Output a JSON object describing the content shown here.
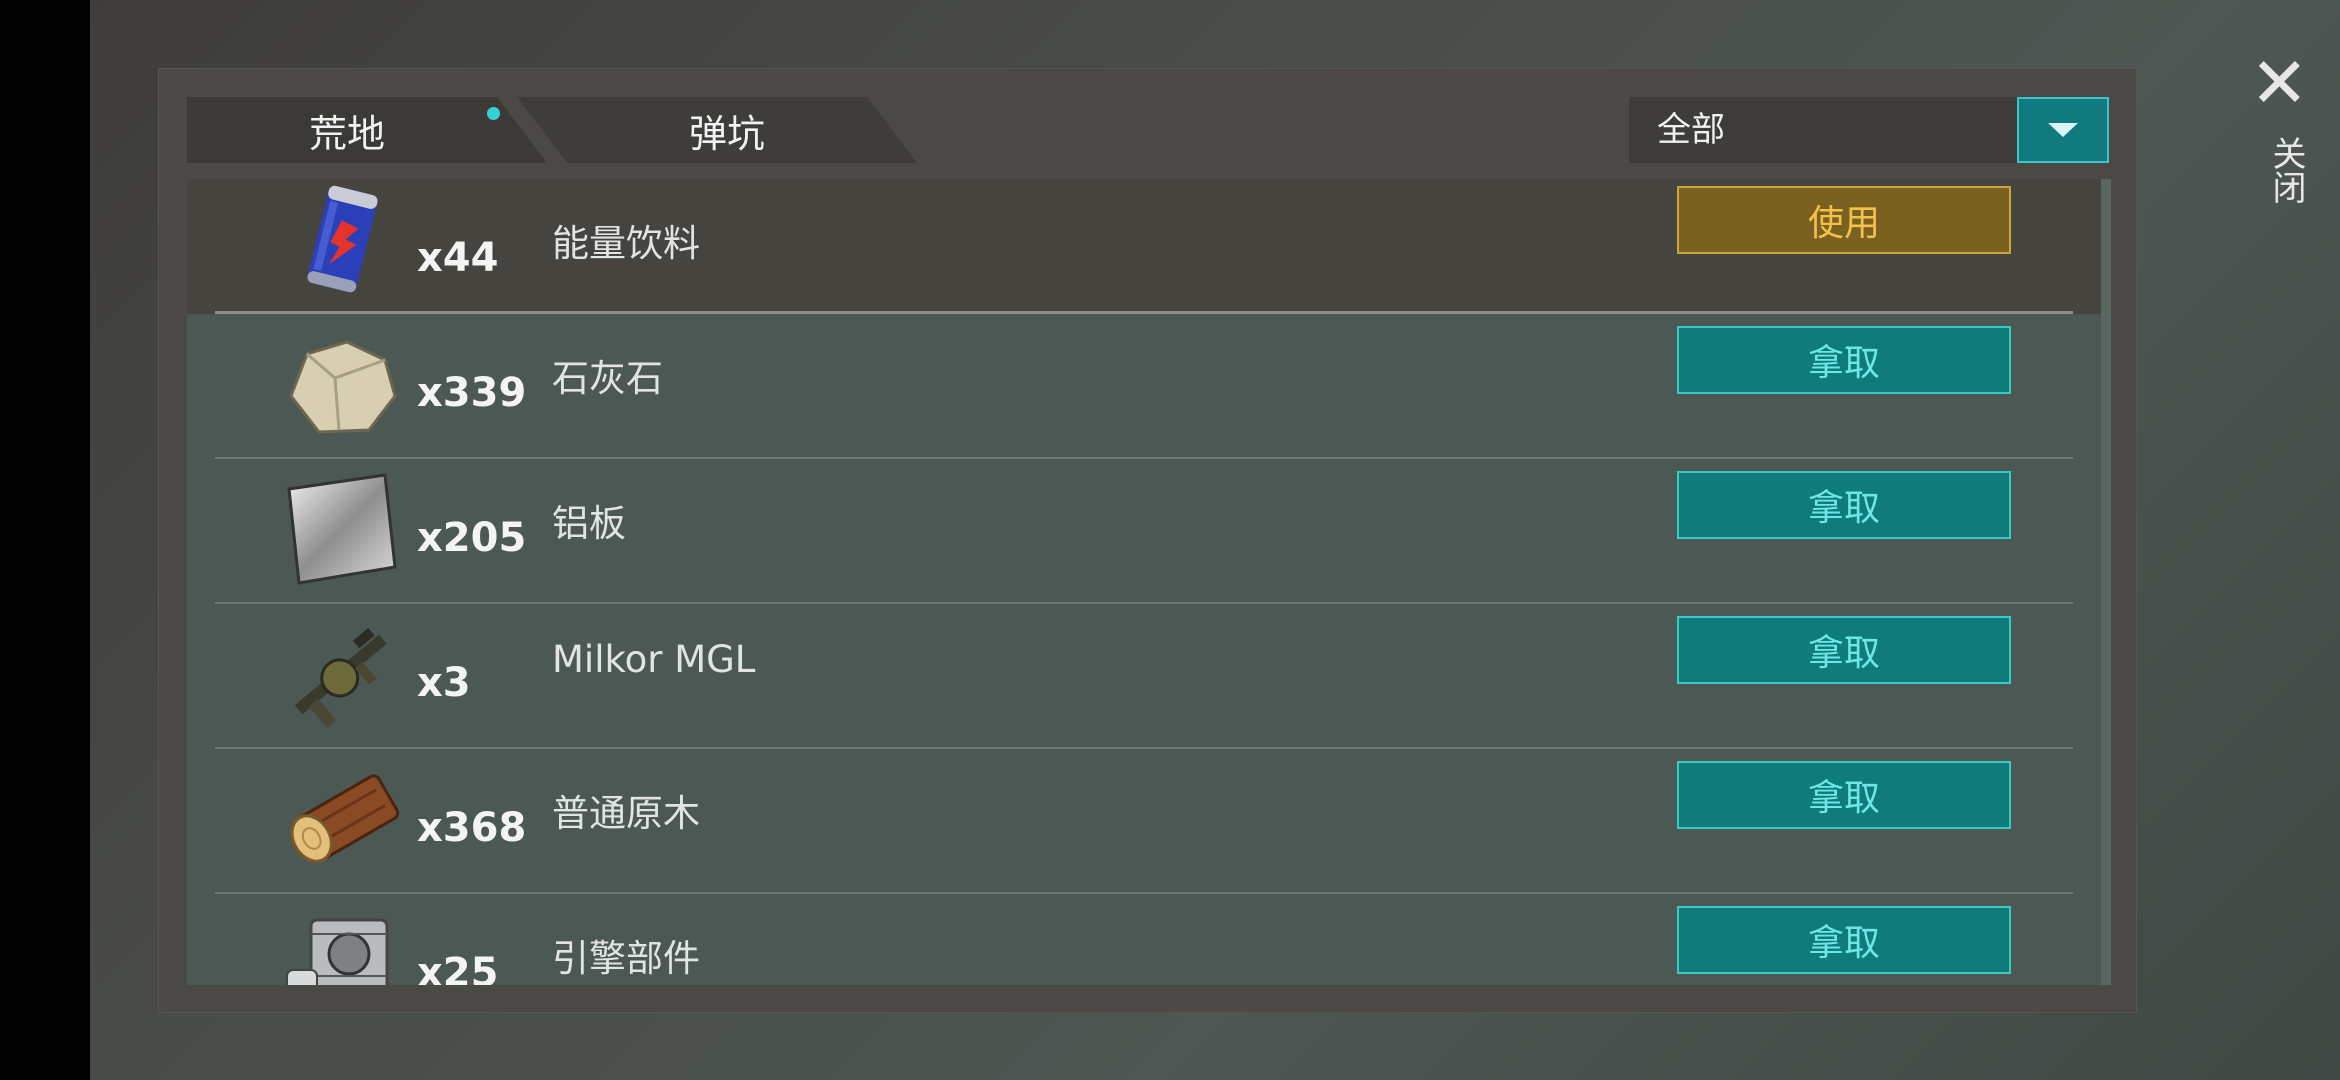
{
  "tabs": [
    {
      "label": "荒地",
      "active": true,
      "has_dot": true
    },
    {
      "label": "弹坑",
      "active": false
    }
  ],
  "filter": {
    "selected": "全部",
    "icon": "chevron-down-icon"
  },
  "items": [
    {
      "name": "能量饮料",
      "qty": "x44",
      "action": "使用",
      "icon": "energy-drink-icon"
    },
    {
      "name": "石灰石",
      "qty": "x339",
      "action": "拿取",
      "icon": "limestone-icon"
    },
    {
      "name": "铝板",
      "qty": "x205",
      "action": "拿取",
      "icon": "aluminum-plate-icon"
    },
    {
      "name": "Milkor MGL",
      "qty": "x3",
      "action": "拿取",
      "icon": "grenade-launcher-icon"
    },
    {
      "name": "普通原木",
      "qty": "x368",
      "action": "拿取",
      "icon": "log-icon"
    },
    {
      "name": "引擎部件",
      "qty": "x25",
      "action": "拿取",
      "icon": "engine-part-icon"
    }
  ],
  "close": {
    "label": "关闭",
    "icon": "close-icon"
  },
  "colors": {
    "accent": "#3ec3c8",
    "use_button": "#7a6120",
    "take_button": "#0f7b7b"
  }
}
